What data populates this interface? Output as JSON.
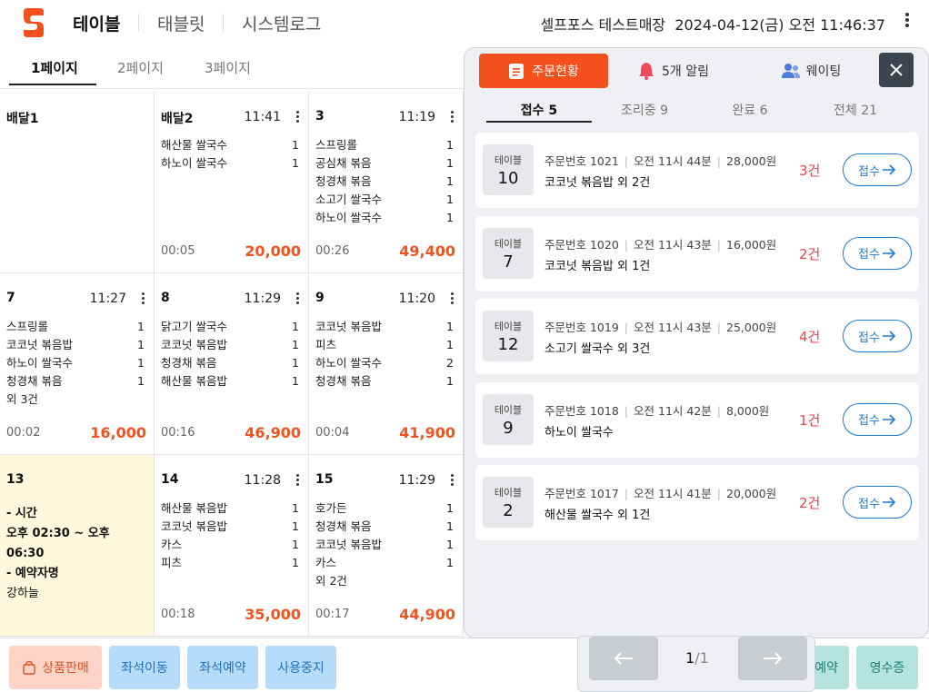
{
  "header": {
    "nav": [
      "테이블",
      "태블릿",
      "시스템로그"
    ],
    "store": "셀프포스 테스트매장",
    "datetime": "2024-04-12(금)  오전 11:46:37"
  },
  "page_tabs": [
    "1페이지",
    "2페이지",
    "3페이지"
  ],
  "tables": [
    {
      "name": "배달1",
      "time": "",
      "items": [],
      "more": "",
      "elapsed": "",
      "total": ""
    },
    {
      "name": "배달2",
      "time": "11:41",
      "items": [
        {
          "n": "해산물 쌀국수",
          "q": "1"
        },
        {
          "n": "하노이 쌀국수",
          "q": "1"
        }
      ],
      "more": "",
      "elapsed": "00:05",
      "total": "20,000"
    },
    {
      "name": "3",
      "time": "11:19",
      "items": [
        {
          "n": "스프링롤",
          "q": "1"
        },
        {
          "n": "공심채 볶음",
          "q": "1"
        },
        {
          "n": "청경채 볶음",
          "q": "1"
        },
        {
          "n": "소고기 쌀국수",
          "q": "1"
        },
        {
          "n": "하노이 쌀국수",
          "q": "1"
        }
      ],
      "more": "",
      "elapsed": "00:26",
      "total": "49,400"
    },
    {
      "name": "7",
      "time": "11:27",
      "items": [
        {
          "n": "스프링롤",
          "q": "1"
        },
        {
          "n": "코코넛 볶음밥",
          "q": "1"
        },
        {
          "n": "하노이 쌀국수",
          "q": "1"
        },
        {
          "n": "청경채 볶음",
          "q": "1"
        }
      ],
      "more": "외 3건",
      "elapsed": "00:02",
      "total": "16,000"
    },
    {
      "name": "8",
      "time": "11:29",
      "items": [
        {
          "n": "닭고기 쌀국수",
          "q": "1"
        },
        {
          "n": "코코넛 볶음밥",
          "q": "1"
        },
        {
          "n": "청경채 볶음",
          "q": "1"
        },
        {
          "n": "해산물 볶음밥",
          "q": "1"
        }
      ],
      "more": "",
      "elapsed": "00:16",
      "total": "46,900"
    },
    {
      "name": "9",
      "time": "11:20",
      "items": [
        {
          "n": "코코넛 볶음밥",
          "q": "1"
        },
        {
          "n": "피츠",
          "q": "1"
        },
        {
          "n": "하노이 쌀국수",
          "q": "2"
        },
        {
          "n": "청경채 볶음",
          "q": "1"
        }
      ],
      "more": "",
      "elapsed": "00:04",
      "total": "41,900"
    },
    {
      "name": "13",
      "time": "",
      "items": [],
      "more": "",
      "elapsed": "",
      "total": "",
      "reservation": [
        "- 시간",
        "오후 02:30 ~ 오후 06:30",
        "- 예약자명",
        "강하늘"
      ]
    },
    {
      "name": "14",
      "time": "11:28",
      "items": [
        {
          "n": "해산물 볶음밥",
          "q": "1"
        },
        {
          "n": "코코넛 볶음밥",
          "q": "1"
        },
        {
          "n": "카스",
          "q": "1"
        },
        {
          "n": "피츠",
          "q": "1"
        }
      ],
      "more": "",
      "elapsed": "00:18",
      "total": "35,000"
    },
    {
      "name": "15",
      "time": "11:29",
      "items": [
        {
          "n": "호가든",
          "q": "1"
        },
        {
          "n": "청경채 볶음",
          "q": "1"
        },
        {
          "n": "코코넛 볶음밥",
          "q": "1"
        },
        {
          "n": "카스",
          "q": "1"
        }
      ],
      "more": "외 2건",
      "elapsed": "00:17",
      "total": "44,900"
    }
  ],
  "bottom_buttons": [
    "상품판매",
    "좌석이동",
    "좌석예약",
    "사용중지",
    "예약",
    "영수증"
  ],
  "panel": {
    "top_tabs": [
      "주문현황",
      "5개 알림",
      "웨이팅"
    ],
    "status_tabs": [
      "접수 5",
      "조리중 9",
      "완료 6",
      "전체 21"
    ],
    "orders": [
      {
        "table_label": "테이블",
        "table": "10",
        "order_no": "주문번호 1021",
        "time": "오전 11시 44분",
        "amount": "28,000원",
        "menu": "코코넛 볶음밥 외 2건",
        "count": "3건",
        "action": "접수"
      },
      {
        "table_label": "테이블",
        "table": "7",
        "order_no": "주문번호 1020",
        "time": "오전 11시 43분",
        "amount": "16,000원",
        "menu": "코코넛 볶음밥 외 1건",
        "count": "2건",
        "action": "접수"
      },
      {
        "table_label": "테이블",
        "table": "12",
        "order_no": "주문번호 1019",
        "time": "오전 11시 43분",
        "amount": "25,000원",
        "menu": "소고기 쌀국수 외 3건",
        "count": "4건",
        "action": "접수"
      },
      {
        "table_label": "테이블",
        "table": "9",
        "order_no": "주문번호 1018",
        "time": "오전 11시 42분",
        "amount": "8,000원",
        "menu": "하노이 쌀국수",
        "count": "1건",
        "action": "접수"
      },
      {
        "table_label": "테이블",
        "table": "2",
        "order_no": "주문번호 1017",
        "time": "오전 11시 41분",
        "amount": "20,000원",
        "menu": "해산물 쌀국수 외 1건",
        "count": "2건",
        "action": "접수"
      }
    ],
    "pager": {
      "current": "1",
      "total": "/1"
    }
  },
  "colors": {
    "accent": "#f4501e",
    "reserved_bg": "#fff8dd",
    "count_red": "#e8434f",
    "accept_blue": "#1d7ad6"
  }
}
